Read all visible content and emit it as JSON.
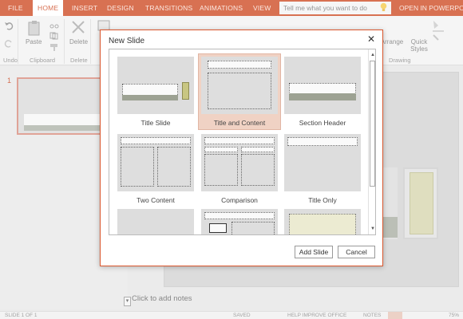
{
  "ribbon": {
    "tabs": [
      "FILE",
      "HOME",
      "INSERT",
      "DESIGN",
      "TRANSITIONS",
      "ANIMATIONS",
      "VIEW"
    ],
    "active_tab": "HOME",
    "tell_me_placeholder": "Tell me what you want to do",
    "open_in": "OPEN IN POWERPOINT",
    "buttons": {
      "paste": "Paste",
      "delete": "Delete",
      "arrange": "Arrange",
      "quick_styles": "Quick Styles"
    },
    "groups": {
      "undo": "Undo",
      "clipboard": "Clipboard",
      "delete": "Delete",
      "drawing": "Drawing"
    }
  },
  "thumbnails": {
    "slide_number": "1"
  },
  "notes": {
    "placeholder": "Click to add notes"
  },
  "status": {
    "slide_of": "SLIDE 1 OF 1",
    "saved": "SAVED",
    "help": "HELP IMPROVE OFFICE",
    "notes": "NOTES",
    "zoom": "75%"
  },
  "dialog": {
    "title": "New Slide",
    "close_glyph": "✕",
    "layouts": [
      {
        "name": "Title Slide"
      },
      {
        "name": "Title and Content",
        "selected": true
      },
      {
        "name": "Section Header"
      },
      {
        "name": "Two Content"
      },
      {
        "name": "Comparison"
      },
      {
        "name": "Title Only"
      }
    ],
    "add_button": "Add Slide",
    "cancel_button": "Cancel"
  },
  "colors": {
    "accent": "#cd4a22",
    "dialog_border": "#d9572e",
    "selection": "#f0d2c4"
  }
}
